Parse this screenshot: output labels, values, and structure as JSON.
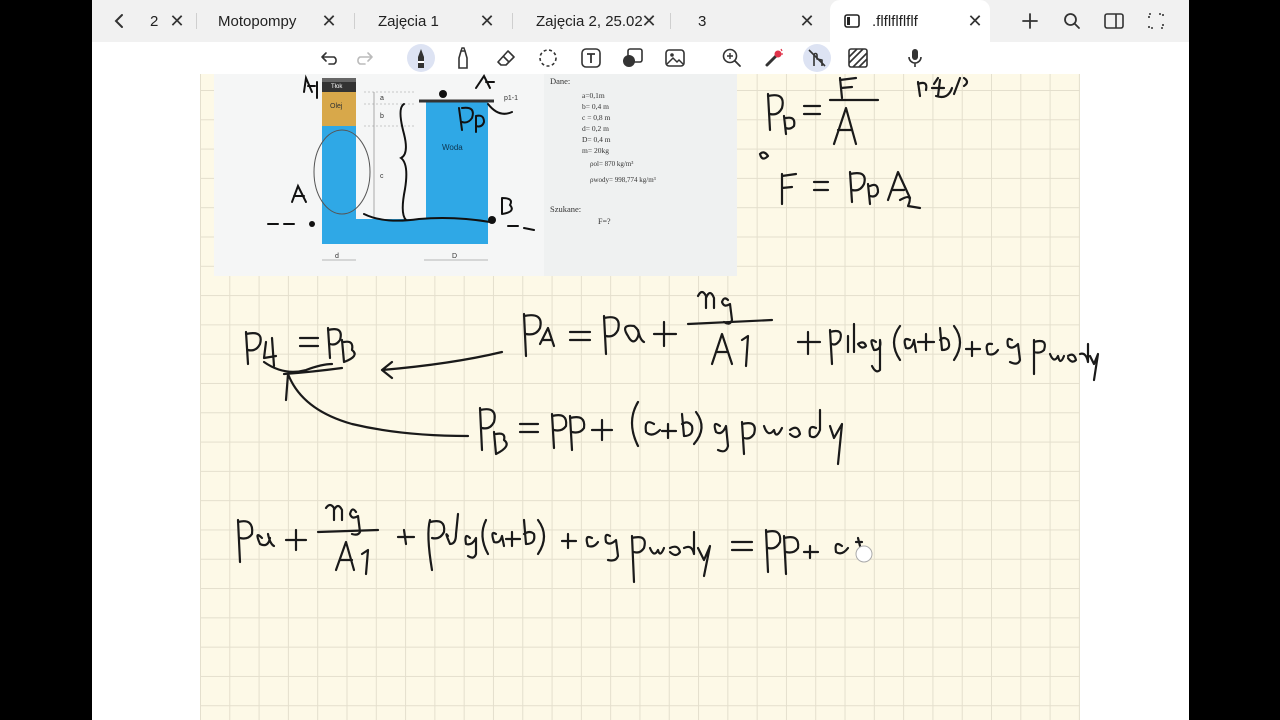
{
  "tabs": [
    {
      "label": "2"
    },
    {
      "label": "Motopompy"
    },
    {
      "label": "Zajęcia 1"
    },
    {
      "label": "Zajęcia 2, 25.02"
    },
    {
      "label": "3"
    },
    {
      "label": ".flflflflflf"
    }
  ],
  "close_glyph": "✕",
  "toolbar_icons": [
    "undo-icon",
    "redo-icon",
    "pen-icon",
    "highlighter-icon",
    "eraser-icon",
    "lasso-icon",
    "text-icon",
    "shape-icon",
    "image-icon",
    "zoom-icon",
    "laser-pointer-icon",
    "touch-draw-icon",
    "pattern-icon",
    "microphone-icon"
  ],
  "diagram": {
    "dane_title": "Dane:",
    "given": [
      "a=0,1m",
      "b= 0,4 m",
      "c = 0,8 m",
      "d= 0,2 m",
      "D= 0,4 m",
      "m= 20kg",
      "ρol= 870 kg/m³",
      "ρwody= 998,774 kg/m³"
    ],
    "szukane_title": "Szukane:",
    "szukane_value": "F=?",
    "label_tlok": "Tłok",
    "label_olej": "Olej",
    "label_woda": "Woda",
    "label_p11": "p1-1",
    "dim_a": "a",
    "dim_b": "b",
    "dim_c": "c",
    "dim_d": "d",
    "dim_D": "D"
  },
  "handwriting": {
    "top_right_1": "Pp = F / A",
    "top_right_2": "F = Pp A2",
    "eq_equal": "PA = PB",
    "eq_pa": "PA = Pa + mg/A1 + ρol·g(a+b) + c g ρwody",
    "eq_pb": "PB = Pp + (c+b) g ρwody",
    "eq_combined": "Pa + mg/A1 + ρol g(a+b) + c g ρwody = Pp + c"
  },
  "colors": {
    "tab_bg": "#f1f1f1",
    "paper": "#fdf9e7",
    "grid": "#e4dfcd",
    "water": "#2fa8e6",
    "oil": "#d8a84a",
    "ink": "#1a1a1a"
  }
}
